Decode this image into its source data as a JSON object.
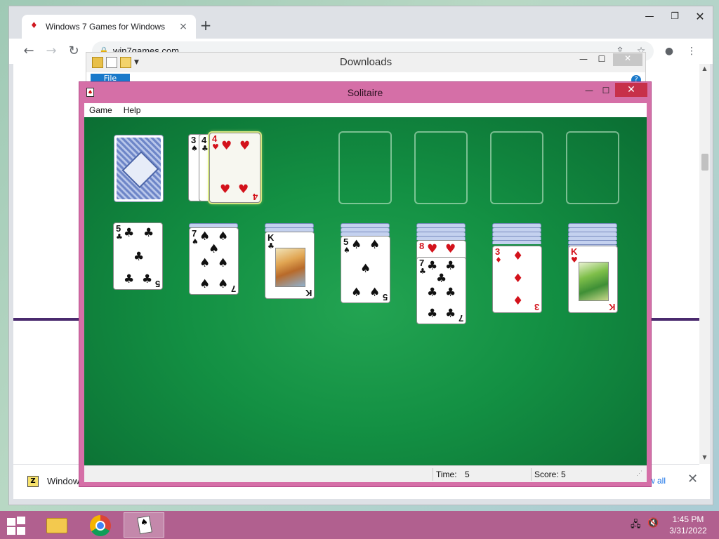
{
  "browser": {
    "tab_title": "Windows 7 Games for Windows",
    "tab_close": "×",
    "new_tab": "+",
    "url": "win7games.com",
    "download": {
      "name": "Window",
      "show_all": "w all"
    }
  },
  "explorer": {
    "title": "Downloads",
    "ribbon": {
      "file_tab": "File",
      "help": "?"
    }
  },
  "solitaire": {
    "title": "Solitaire",
    "menu": [
      "Game",
      "Help"
    ],
    "status": {
      "time_label": "Time:",
      "time_value": "5",
      "score_label": "Score: 5"
    },
    "waste": [
      {
        "rank": "3",
        "suit": "♠",
        "color": "black"
      },
      {
        "rank": "4",
        "suit": "♣",
        "color": "black"
      },
      {
        "rank": "4",
        "suit": "♥",
        "color": "red"
      }
    ],
    "tableau": [
      {
        "hidden": 0,
        "rank": "5",
        "suit": "♣",
        "color": "black"
      },
      {
        "hidden": 1,
        "rank": "7",
        "suit": "♠",
        "color": "black"
      },
      {
        "hidden": 2,
        "rank": "K",
        "suit": "♣",
        "color": "black"
      },
      {
        "hidden": 3,
        "rank": "5",
        "suit": "♠",
        "color": "black"
      },
      {
        "hidden": 4,
        "partial": {
          "rank": "8",
          "suit": "♥",
          "color": "red"
        },
        "rank": "7",
        "suit": "♣",
        "color": "black"
      },
      {
        "hidden": 5,
        "rank": "3",
        "suit": "♦",
        "color": "red"
      },
      {
        "hidden": 6,
        "rank": "K",
        "suit": "♥",
        "color": "red"
      }
    ]
  },
  "taskbar": {
    "time": "1:45 PM",
    "date": "3/31/2022"
  },
  "colors": {
    "felt": "#139043",
    "solitaire_frame": "#d56fa7",
    "taskbar": "#b1608f"
  }
}
